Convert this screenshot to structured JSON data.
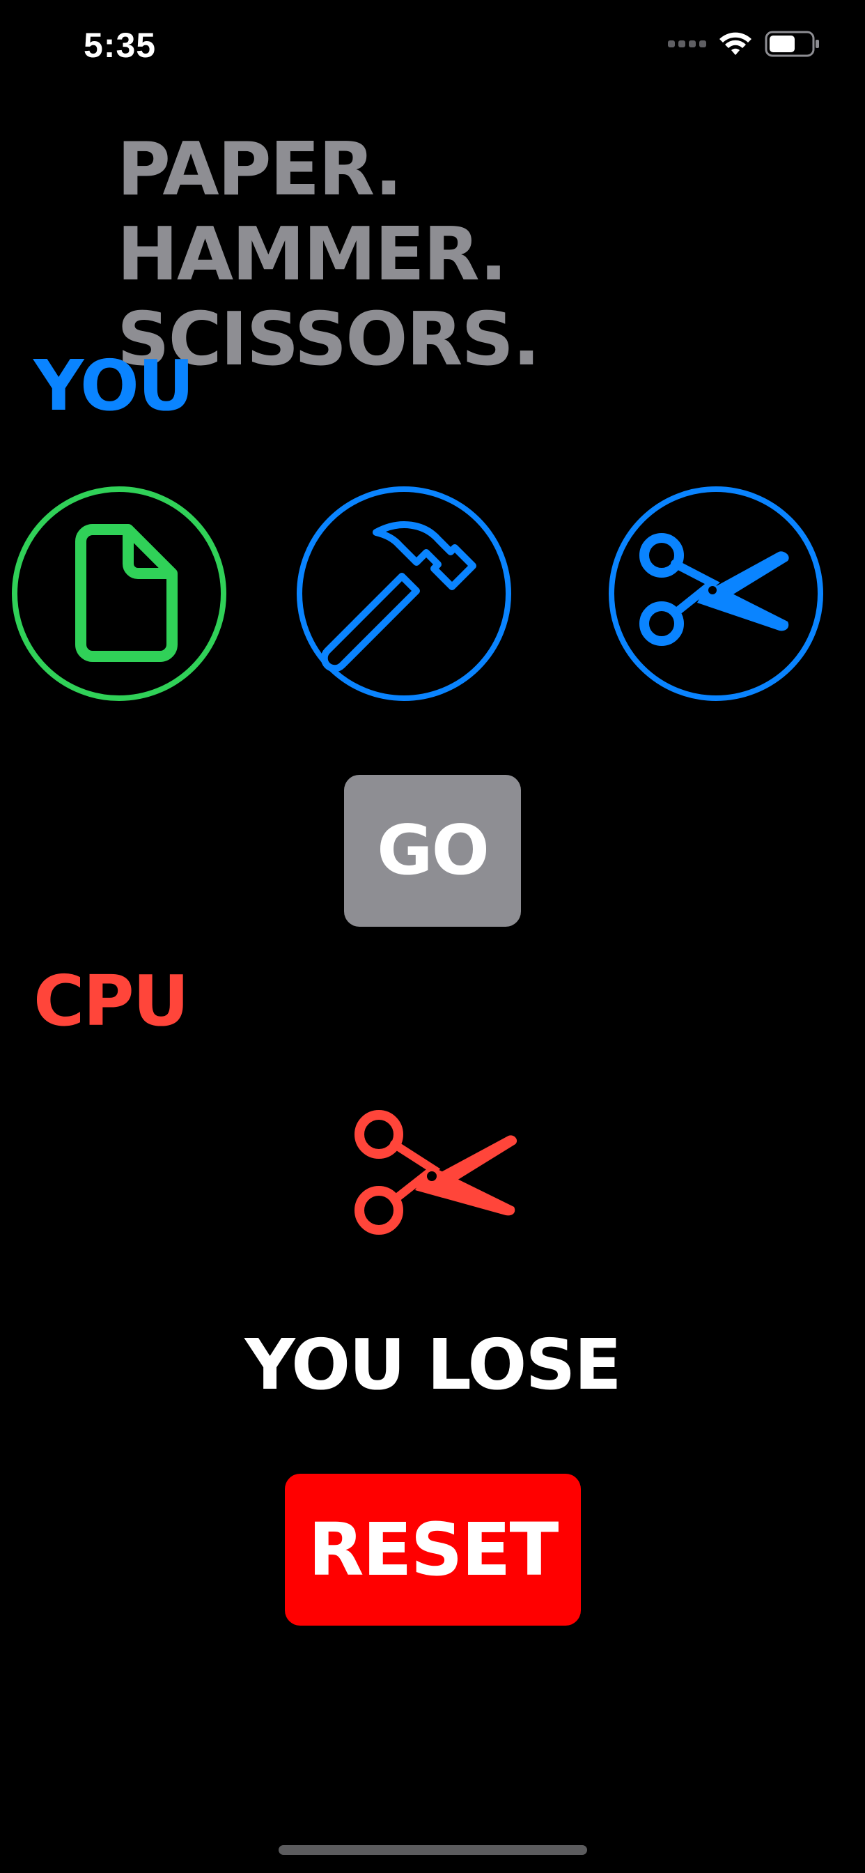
{
  "status_bar": {
    "time": "5:35",
    "icons": [
      "signal-icon",
      "wifi-icon",
      "battery-icon"
    ]
  },
  "app": {
    "title_line1": "PAPER. HAMMER.",
    "title_line2": "SCISSORS."
  },
  "player": {
    "label": "YOU",
    "choices": [
      {
        "name": "paper",
        "icon": "paper-icon",
        "selected": true,
        "color": "#30d158"
      },
      {
        "name": "hammer",
        "icon": "hammer-icon",
        "selected": false,
        "color": "#0a84ff"
      },
      {
        "name": "scissors",
        "icon": "scissors-icon",
        "selected": false,
        "color": "#0a84ff"
      }
    ]
  },
  "go_button": {
    "label": "GO",
    "color": "#8e8e93"
  },
  "cpu": {
    "label": "CPU",
    "choice": "scissors",
    "icon": "scissors-icon",
    "color": "#ff453a"
  },
  "result": {
    "text": "YOU LOSE"
  },
  "reset_button": {
    "label": "RESET",
    "color": "#ff0000"
  },
  "colors": {
    "background": "#000000",
    "you": "#0a84ff",
    "cpu": "#ff453a",
    "selected": "#30d158",
    "title": "#8e8e93"
  }
}
